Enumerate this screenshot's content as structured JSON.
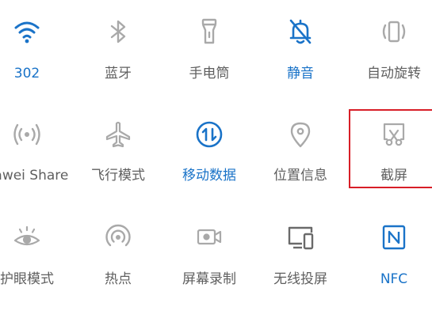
{
  "colors": {
    "active": "#1a73c8",
    "inactive_icon": "#a9a9a9",
    "inactive_text": "#5f5f5f",
    "highlight": "#d81e27"
  },
  "tiles": [
    {
      "label": "302",
      "icon": "wifi-icon",
      "active": true
    },
    {
      "label": "蓝牙",
      "icon": "bluetooth-icon",
      "active": false
    },
    {
      "label": "手电筒",
      "icon": "flashlight-icon",
      "active": false
    },
    {
      "label": "静音",
      "icon": "bell-muted-icon",
      "active": true
    },
    {
      "label": "自动旋转",
      "icon": "auto-rotate-icon",
      "active": false
    },
    {
      "label": "uawei Share",
      "icon": "huawei-share-icon",
      "active": false
    },
    {
      "label": "飞行模式",
      "icon": "airplane-icon",
      "active": false
    },
    {
      "label": "移动数据",
      "icon": "mobile-data-icon",
      "active": true
    },
    {
      "label": "位置信息",
      "icon": "location-pin-icon",
      "active": false
    },
    {
      "label": "截屏",
      "icon": "screenshot-icon",
      "active": false
    },
    {
      "label": "护眼模式",
      "icon": "eye-comfort-icon",
      "active": false
    },
    {
      "label": "热点",
      "icon": "hotspot-icon",
      "active": false
    },
    {
      "label": "屏幕录制",
      "icon": "screen-record-icon",
      "active": false
    },
    {
      "label": "无线投屏",
      "icon": "wireless-projection-icon",
      "active": false
    },
    {
      "label": "NFC",
      "icon": "nfc-icon",
      "active": true
    }
  ]
}
